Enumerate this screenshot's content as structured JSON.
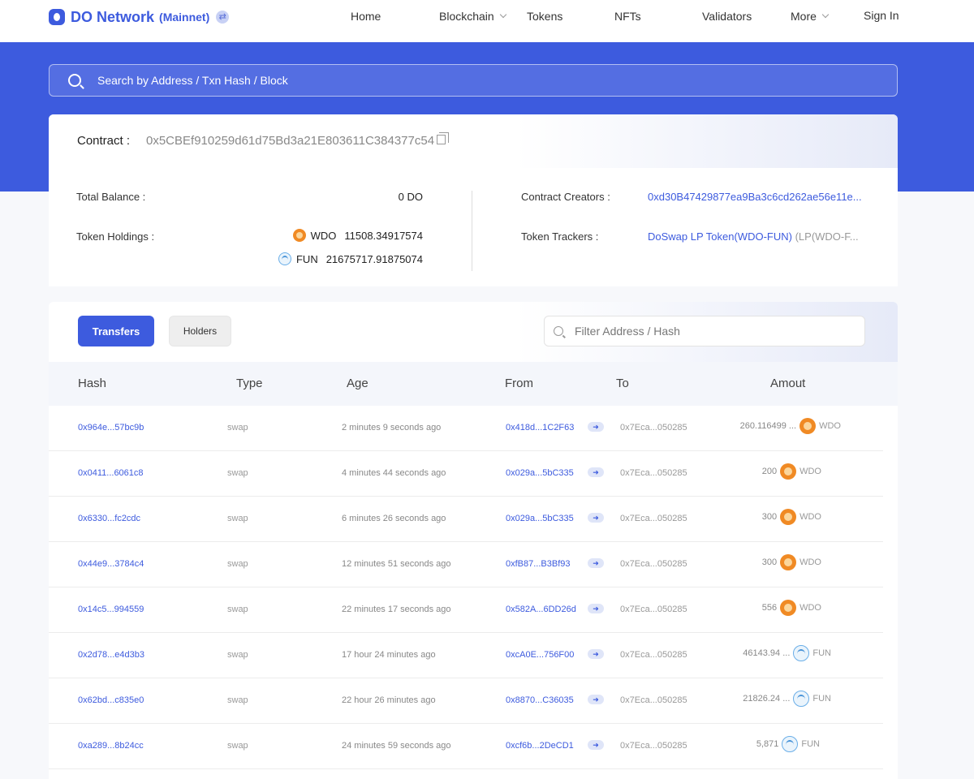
{
  "header": {
    "brand": "DO Network",
    "network": "(Mainnet)",
    "nav": {
      "home": "Home",
      "blockchain": "Blockchain",
      "tokens": "Tokens",
      "nfts": "NFTs",
      "validators": "Validators",
      "more": "More",
      "sign_in": "Sign In"
    }
  },
  "search": {
    "placeholder": "Search by Address / Txn Hash / Block"
  },
  "contract": {
    "label": "Contract :",
    "address": "0x5CBEf910259d61d75Bd3a21E803611C384377c54",
    "total_balance_label": "Total Balance :",
    "total_balance_value": "0 DO",
    "token_holdings_label": "Token Holdings :",
    "holdings": [
      {
        "symbol": "WDO",
        "amount": "11508.34917574"
      },
      {
        "symbol": "FUN",
        "amount": "21675717.91875074"
      }
    ],
    "creators_label": "Contract Creators :",
    "creators_value": "0xd30B47429877ea9Ba3c6cd262ae56e11e...",
    "trackers_label": "Token Trackers :",
    "trackers_link": "DoSwap LP Token(WDO-FUN)",
    "trackers_suffix": "(LP(WDO-F..."
  },
  "tabs": {
    "transfers": "Transfers",
    "holders": "Holders"
  },
  "filter": {
    "placeholder": "Filter Address / Hash"
  },
  "table": {
    "columns": {
      "hash": "Hash",
      "type": "Type",
      "age": "Age",
      "from": "From",
      "to": "To",
      "amount": "Amout"
    },
    "rows": [
      {
        "hash": "0x964e...57bc9b",
        "type": "swap",
        "age": "2 minutes 9 seconds ago",
        "from": "0x418d...1C2F63",
        "to": "0x7Eca...050285",
        "amount": "260.116499 ...",
        "symbol": "WDO"
      },
      {
        "hash": "0x0411...6061c8",
        "type": "swap",
        "age": "4 minutes 44 seconds ago",
        "from": "0x029a...5bC335",
        "to": "0x7Eca...050285",
        "amount": "200",
        "symbol": "WDO"
      },
      {
        "hash": "0x6330...fc2cdc",
        "type": "swap",
        "age": "6 minutes 26 seconds ago",
        "from": "0x029a...5bC335",
        "to": "0x7Eca...050285",
        "amount": "300",
        "symbol": "WDO"
      },
      {
        "hash": "0x44e9...3784c4",
        "type": "swap",
        "age": "12 minutes 51 seconds ago",
        "from": "0xfB87...B3Bf93",
        "to": "0x7Eca...050285",
        "amount": "300",
        "symbol": "WDO"
      },
      {
        "hash": "0x14c5...994559",
        "type": "swap",
        "age": "22 minutes 17 seconds ago",
        "from": "0x582A...6DD26d",
        "to": "0x7Eca...050285",
        "amount": "556",
        "symbol": "WDO"
      },
      {
        "hash": "0x2d78...e4d3b3",
        "type": "swap",
        "age": "17 hour 24 minutes ago",
        "from": "0xcA0E...756F00",
        "to": "0x7Eca...050285",
        "amount": "46143.94 ...",
        "symbol": "FUN"
      },
      {
        "hash": "0x62bd...c835e0",
        "type": "swap",
        "age": "22 hour 26 minutes ago",
        "from": "0x8870...C36035",
        "to": "0x7Eca...050285",
        "amount": "21826.24 ...",
        "symbol": "FUN"
      },
      {
        "hash": "0xa289...8b24cc",
        "type": "swap",
        "age": "24 minutes 59 seconds ago",
        "from": "0xcf6b...2DeCD1",
        "to": "0x7Eca...050285",
        "amount": "5,871",
        "symbol": "FUN"
      }
    ]
  },
  "colors": {
    "brand": "#3d5bde",
    "wdo": "#f08a24",
    "fun": "#4a94d8"
  }
}
